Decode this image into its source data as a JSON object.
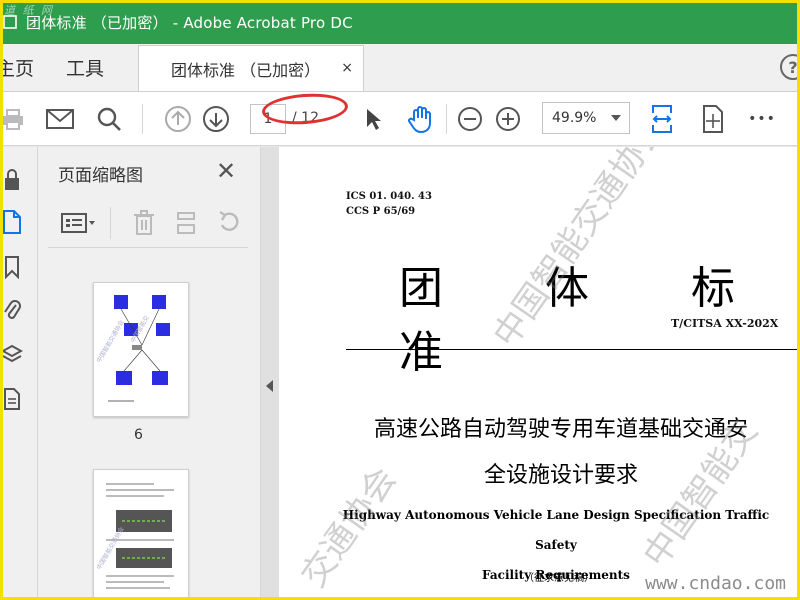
{
  "window": {
    "title": "团体标准 （已加密） - Adobe Acrobat Pro DC",
    "corner_watermark": "道 纸 网"
  },
  "nav": {
    "home_label": "主页",
    "tools_label": "工具",
    "doc_tab_label": "团体标准 （已加密）",
    "close_symbol": "×",
    "help_symbol": "?"
  },
  "toolbar": {
    "page_current": "1",
    "page_total": "/ 12",
    "zoom": "49.9%",
    "more_symbol": "•••"
  },
  "panel": {
    "title": "页面缩略图",
    "close_symbol": "✕",
    "thumb_1_label": "6"
  },
  "document": {
    "ics_line": "ICS 01. 040. 43",
    "ccs_line": "CCS P 65/69",
    "big_title": "团 体 标 准",
    "std_number": "T/CITSA XX-202X",
    "cn_title_line1": "高速公路自动驾驶专用车道基础交通安",
    "cn_title_line2": "全设施设计要求",
    "en_title_line1": "Highway Autonomous Vehicle Lane Design Specification Traffic Safety",
    "en_title_line2": "Facility Requirements",
    "draft_note": "（征求意见稿）",
    "watermark_text_1": "中国智能交通协会",
    "watermark_text_2": "中国智能交",
    "watermark_text_3": "交通协会"
  },
  "site_watermark": "www.cndao.com",
  "colors": {
    "titlebar": "#2e9d4e",
    "frame": "#f2e100",
    "accent_blue": "#1473e6",
    "annotation_red": "#e03030"
  }
}
